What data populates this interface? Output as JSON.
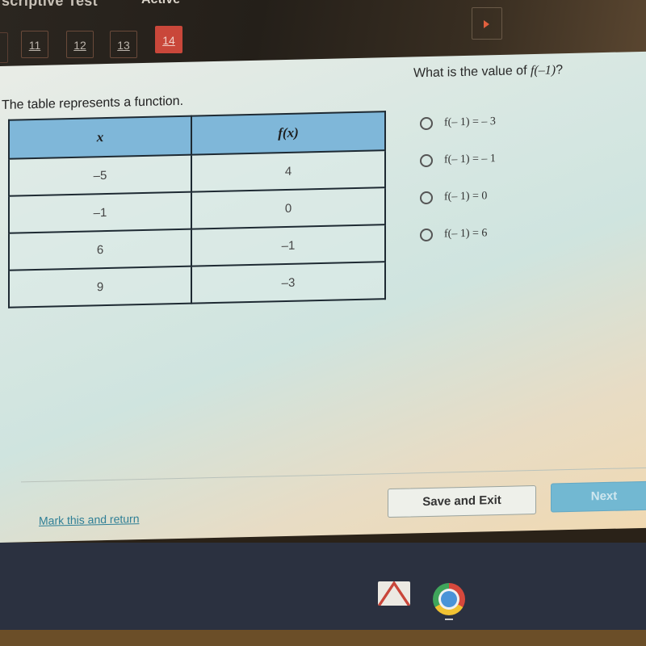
{
  "header": {
    "test_title": "scriptive Test",
    "status": "Active",
    "question_nav": [
      {
        "label": "11",
        "active": false
      },
      {
        "label": "12",
        "active": false
      },
      {
        "label": "13",
        "active": false
      },
      {
        "label": "14",
        "active": true
      }
    ],
    "flag_icon": "flag-icon",
    "accent_color": "#c9473a"
  },
  "main": {
    "prompt": "The table represents a function.",
    "table": {
      "headers": [
        "x",
        "f(x)"
      ],
      "rows": [
        [
          "–5",
          "4"
        ],
        [
          "–1",
          "0"
        ],
        [
          "6",
          "–1"
        ],
        [
          "9",
          "–3"
        ]
      ]
    },
    "question": {
      "prefix": "What is the value of ",
      "expression": "f(–1)",
      "suffix": "?"
    },
    "options": [
      {
        "label": "f(– 1) = – 3",
        "selected": false
      },
      {
        "label": "f(– 1) = – 1",
        "selected": false
      },
      {
        "label": "f(– 1) = 0",
        "selected": false
      },
      {
        "label": "f(– 1) = 6",
        "selected": false
      }
    ],
    "mark_link": "Mark this and return",
    "save_button": "Save and Exit",
    "next_button": "Next"
  },
  "shelf": {
    "apps": [
      {
        "name": "gmail-icon"
      },
      {
        "name": "chrome-icon",
        "running": true
      }
    ]
  }
}
